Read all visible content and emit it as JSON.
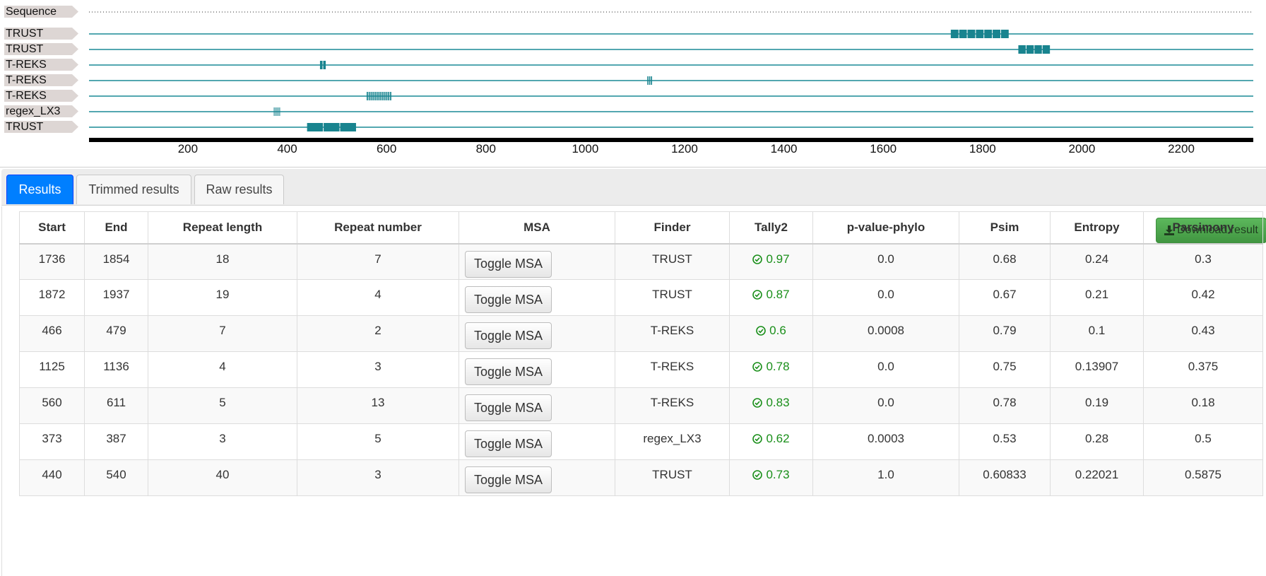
{
  "viewer": {
    "tracks": [
      {
        "label": "Sequence",
        "kind": "sequence"
      },
      {
        "label": "TRUST",
        "kind": "repeat",
        "start": 1736,
        "end": 1854,
        "units": 7
      },
      {
        "label": "TRUST",
        "kind": "repeat",
        "start": 1872,
        "end": 1937,
        "units": 4
      },
      {
        "label": "T-REKS",
        "kind": "repeat",
        "start": 466,
        "end": 479,
        "units": 2
      },
      {
        "label": "T-REKS",
        "kind": "repeat",
        "start": 1125,
        "end": 1136,
        "units": 3
      },
      {
        "label": "T-REKS",
        "kind": "repeat",
        "start": 560,
        "end": 611,
        "units": 13
      },
      {
        "label": "regex_LX3",
        "kind": "repeat",
        "start": 373,
        "end": 387,
        "units": 5
      },
      {
        "label": "TRUST",
        "kind": "repeat",
        "start": 440,
        "end": 540,
        "units": 3
      }
    ],
    "axis_ticks": [
      "200",
      "400",
      "600",
      "800",
      "1000",
      "1200",
      "1400",
      "1600",
      "1800",
      "2000",
      "2200"
    ],
    "axis_min": 1,
    "axis_max": 2345,
    "colors": {
      "track_line": "#1a8a96",
      "block": "#19848f",
      "axis": "#000000",
      "label_bg": "#ddd6d4"
    }
  },
  "tabs": [
    {
      "label": "Results",
      "active": true
    },
    {
      "label": "Trimmed results",
      "active": false
    },
    {
      "label": "Raw results",
      "active": false
    }
  ],
  "download_label": "Download result",
  "table": {
    "headers": [
      "Start",
      "End",
      "Repeat length",
      "Repeat number",
      "MSA",
      "Finder",
      "Tally2",
      "p-value-phylo",
      "Psim",
      "Entropy",
      "Parsimony"
    ],
    "msa_button_label": "Toggle MSA",
    "rows": [
      {
        "start": "1736",
        "end": "1854",
        "repeat_length": "18",
        "repeat_number": "7",
        "finder": "TRUST",
        "tally2": "0.97",
        "p_value_phylo": "0.0",
        "psim": "0.68",
        "entropy": "0.24",
        "parsimony": "0.3"
      },
      {
        "start": "1872",
        "end": "1937",
        "repeat_length": "19",
        "repeat_number": "4",
        "finder": "TRUST",
        "tally2": "0.87",
        "p_value_phylo": "0.0",
        "psim": "0.67",
        "entropy": "0.21",
        "parsimony": "0.42"
      },
      {
        "start": "466",
        "end": "479",
        "repeat_length": "7",
        "repeat_number": "2",
        "finder": "T-REKS",
        "tally2": "0.6",
        "p_value_phylo": "0.0008",
        "psim": "0.79",
        "entropy": "0.1",
        "parsimony": "0.43"
      },
      {
        "start": "1125",
        "end": "1136",
        "repeat_length": "4",
        "repeat_number": "3",
        "finder": "T-REKS",
        "tally2": "0.78",
        "p_value_phylo": "0.0",
        "psim": "0.75",
        "entropy": "0.13907",
        "parsimony": "0.375"
      },
      {
        "start": "560",
        "end": "611",
        "repeat_length": "5",
        "repeat_number": "13",
        "finder": "T-REKS",
        "tally2": "0.83",
        "p_value_phylo": "0.0",
        "psim": "0.78",
        "entropy": "0.19",
        "parsimony": "0.18"
      },
      {
        "start": "373",
        "end": "387",
        "repeat_length": "3",
        "repeat_number": "5",
        "finder": "regex_LX3",
        "tally2": "0.62",
        "p_value_phylo": "0.0003",
        "psim": "0.53",
        "entropy": "0.28",
        "parsimony": "0.5"
      },
      {
        "start": "440",
        "end": "540",
        "repeat_length": "40",
        "repeat_number": "3",
        "finder": "TRUST",
        "tally2": "0.73",
        "p_value_phylo": "1.0",
        "psim": "0.60833",
        "entropy": "0.22021",
        "parsimony": "0.5875"
      }
    ]
  }
}
